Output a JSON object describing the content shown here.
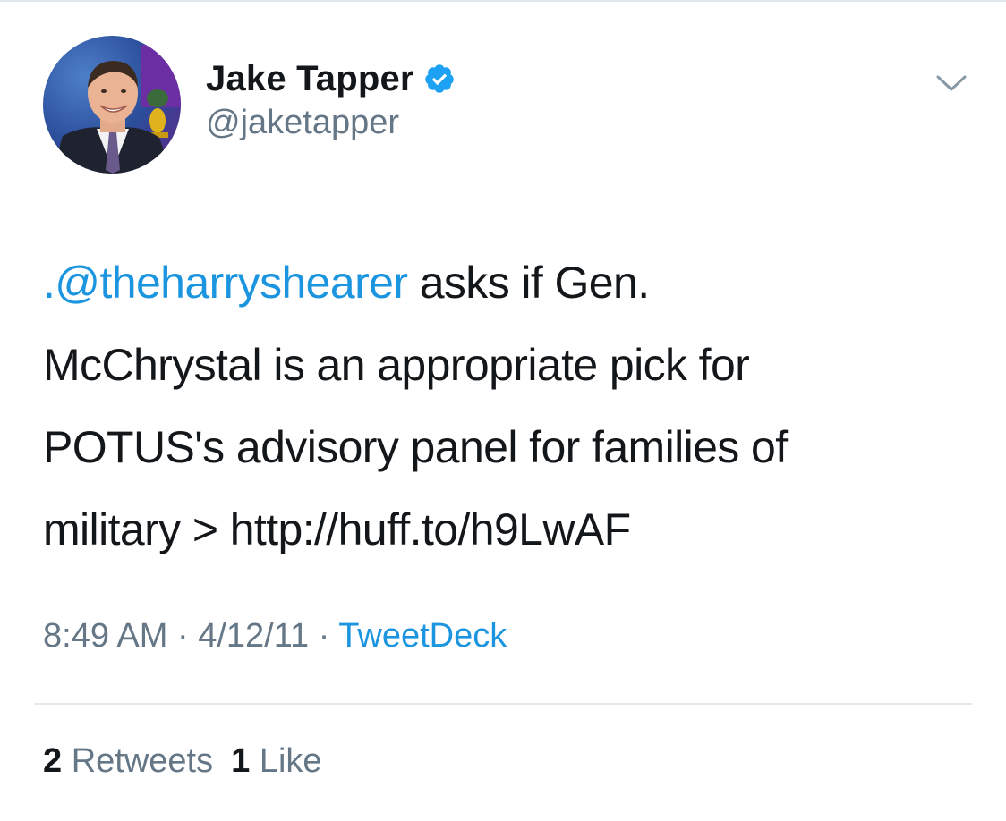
{
  "author": {
    "display_name": "Jake Tapper",
    "handle": "@jaketapper",
    "verified": true,
    "avatar": "profile-photo"
  },
  "icons": {
    "verified": "verified-badge-icon",
    "menu": "chevron-down-icon"
  },
  "tweet": {
    "mention": ".@theharryshearer",
    "line1_rest": " asks if Gen.",
    "line2": "McChrystal is an appropriate pick for",
    "line3": "POTUS's advisory panel for families of",
    "line4": "military > http://huff.to/h9LwAF"
  },
  "meta": {
    "time": "8:49 AM",
    "separator1": " · ",
    "date": "4/12/11",
    "separator2": " · ",
    "source": "TweetDeck"
  },
  "stats": {
    "retweets_count": "2",
    "retweets_label": "Retweets",
    "likes_count": "1",
    "likes_label": "Like"
  },
  "colors": {
    "link": "#1b95e0",
    "secondary_text": "#657786",
    "primary_text": "#14171a",
    "divider": "#e1e8ed",
    "verified_badge": "#1da1f2"
  }
}
